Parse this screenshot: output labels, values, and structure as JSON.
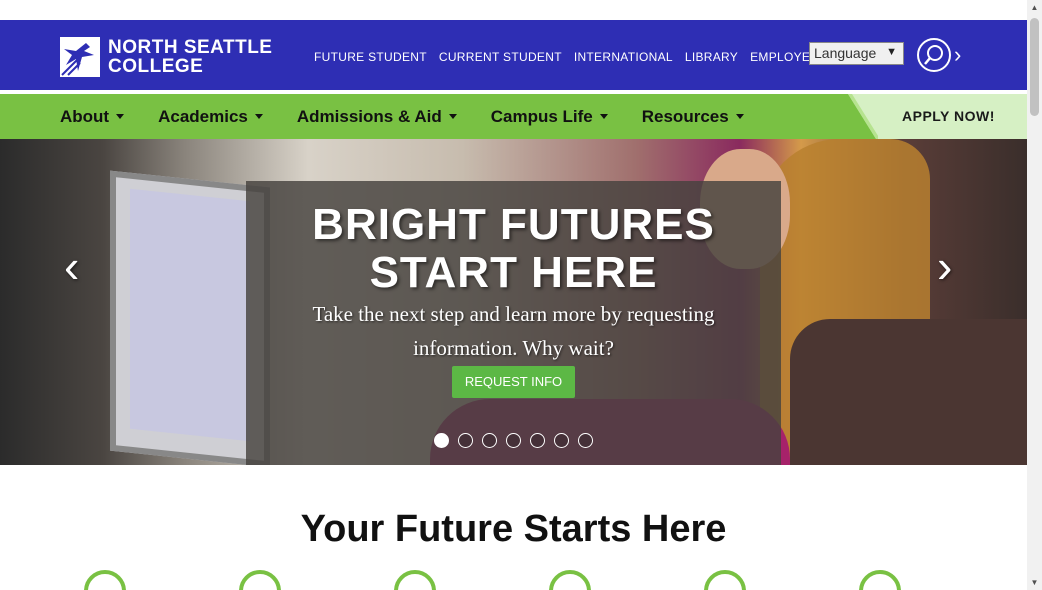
{
  "brand": {
    "line1": "NORTH SEATTLE",
    "line2": "COLLEGE"
  },
  "utility_nav": [
    "FUTURE STUDENT",
    "CURRENT STUDENT",
    "INTERNATIONAL",
    "LIBRARY",
    "EMPLOYEES"
  ],
  "language_select": {
    "value": "Language",
    "arrow": "▼"
  },
  "search": {
    "icon": "search-icon",
    "next_icon": "chevron-right-icon"
  },
  "main_nav": [
    "About",
    "Academics",
    "Admissions & Aid",
    "Campus Life",
    "Resources"
  ],
  "apply_button": "APPLY NOW!",
  "hero": {
    "headline_1": "BRIGHT FUTURES",
    "headline_2": "START HERE",
    "subtext": "Take the next step and learn more by requesting information. Why wait?",
    "cta": "REQUEST INFO",
    "prev": "‹",
    "next": "›",
    "active_slide": 1,
    "total_slides": 7
  },
  "section_title": "Your Future Starts Here",
  "colors": {
    "brand_blue": "#2e2eb4",
    "brand_green": "#79c143",
    "cta_green": "#5cb845"
  }
}
